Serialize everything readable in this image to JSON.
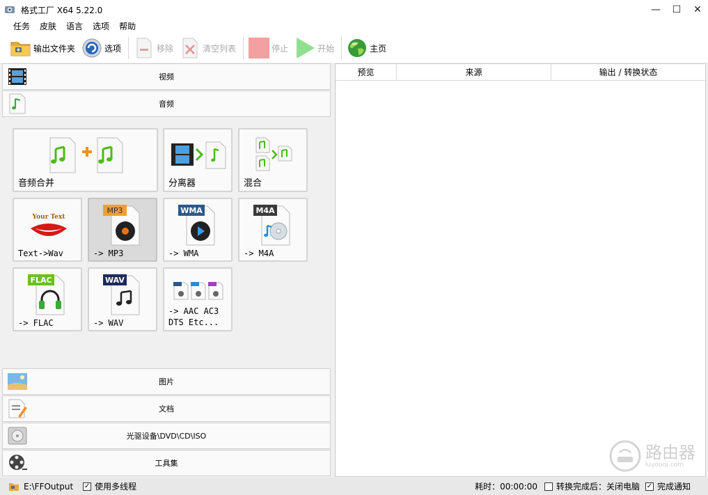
{
  "window": {
    "title": "格式工厂 X64 5.22.0",
    "minimize": "—",
    "maximize": "☐",
    "close": "✕"
  },
  "menu": [
    "任务",
    "皮肤",
    "语言",
    "选项",
    "帮助"
  ],
  "toolbar": {
    "output_folder": "输出文件夹",
    "options": "选项",
    "remove": "移除",
    "clear_list": "清空列表",
    "stop": "停止",
    "start": "开始",
    "home": "主页"
  },
  "categories": {
    "video": "视频",
    "audio": "音频",
    "image": "图片",
    "document": "文档",
    "disc": "光驱设备\\DVD\\CD\\ISO",
    "tools": "工具集"
  },
  "audio_tiles": {
    "merge": "音频合并",
    "splitter": "分离器",
    "mix": "混合",
    "text_wav": "Text->Wav",
    "mp3": "-> MP3",
    "wma": "-> WMA",
    "m4a": "-> M4A",
    "flac": "-> FLAC",
    "wav": "-> WAV",
    "aac": "-> AAC AC3\nDTS Etc...",
    "badge_mp3": "MP3",
    "badge_wma": "WMA",
    "badge_m4a": "M4A",
    "badge_flac": "FLAC",
    "badge_wav": "WAV",
    "your_text": "Your Text"
  },
  "task_list": {
    "columns": [
      "预览",
      "来源",
      "输出 / 转换状态"
    ]
  },
  "status_bar": {
    "output_path": "E:\\FFOutput",
    "multithread": "使用多线程",
    "multithread_checked": true,
    "elapsed": "耗时：00:00:00",
    "after_convert": "转换完成后：关闭电脑",
    "after_convert_checked": false,
    "notify": "完成通知",
    "notify_checked": true
  },
  "watermark": {
    "text": "路由器",
    "sub": "luyouqi.com"
  },
  "colors": {
    "music_green": "#4cbb17",
    "mp3_orange": "#f0a030",
    "wma_blue": "#2a5a8a",
    "m4a_dark": "#3a3a3a",
    "flac_green": "#6ac020",
    "wav_navy": "#1e2a5a",
    "stop_red": "#f4a0a0",
    "start_green": "#8fe08f"
  }
}
